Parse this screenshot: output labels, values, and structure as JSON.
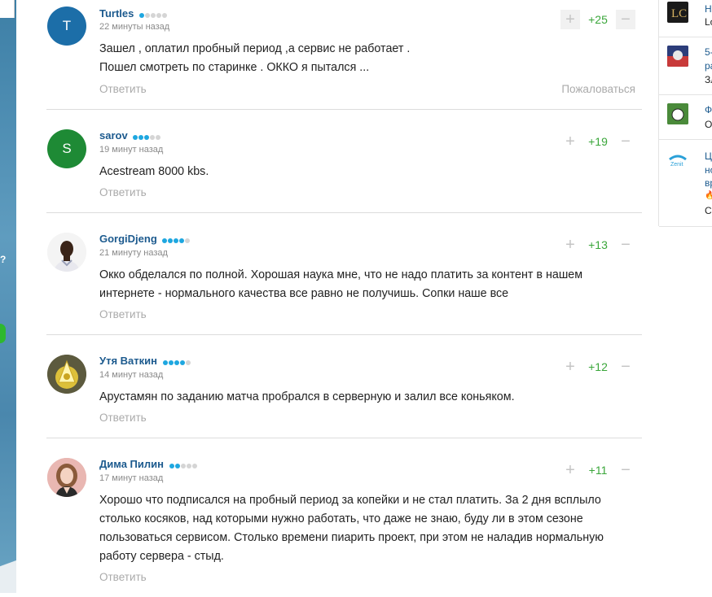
{
  "comments": [
    {
      "user": "Turtles",
      "time": "22 минуты назад",
      "avatar_letter": "T",
      "avatar_color": "#1c6ea8",
      "rating_dots": 1,
      "score": "+25",
      "text_lines": [
        "Зашел , оплатил пробный период ,а сервис не работает .",
        "Пошел смотреть по старинке . ОККО я пытался ..."
      ],
      "reply": "Ответить",
      "complain": "Пожаловаться"
    },
    {
      "user": "sarov",
      "time": "19 минут назад",
      "avatar_letter": "S",
      "avatar_color": "#1e8a35",
      "rating_dots": 3,
      "score": "+19",
      "text_lines": [
        "Acestream 8000 kbs."
      ],
      "reply": "Ответить"
    },
    {
      "user": "GorgiDjeng",
      "time": "21 минуту назад",
      "rating_dots": 4,
      "score": "+13",
      "text_lines": [
        "Окко обделался по полной. Хорошая наука мне, что не надо платить за контент в нашем",
        "интернете - нормального качества все равно не получишь. Сопки наше все"
      ],
      "reply": "Ответить"
    },
    {
      "user": "Утя Ваткин",
      "time": "14 минут назад",
      "rating_dots": 4,
      "score": "+12",
      "text_lines": [
        "Арустамян по заданию матча пробрался в серверную и залил все коньяком."
      ],
      "reply": "Ответить"
    },
    {
      "user": "Дима Пилин",
      "time": "17 минут назад",
      "rating_dots": 2,
      "score": "+11",
      "text_lines": [
        "Хорошо что подписался на пробный период за копейки и не стал платить. За 2 дня всплыло",
        "столько косяков, над которыми нужно работать, что даже не знаю, буду ли в этом сезоне",
        "пользоваться сервисом. Столько времени пиарить проект, при этом не наладив нормальную",
        "работу сервера - стыд."
      ],
      "reply": "Ответить"
    }
  ],
  "sidebar": {
    "news": [
      {
        "line1": "Н",
        "line2": "Lo"
      },
      {
        "line1": "5-",
        "line2": "ра",
        "line3": "Зл"
      },
      {
        "line1": "Ф",
        "line2": "О"
      },
      {
        "line1": "Ц",
        "line2": "но",
        "line3": "вр",
        "line4": "🔥",
        "line5": "Cl"
      }
    ]
  }
}
